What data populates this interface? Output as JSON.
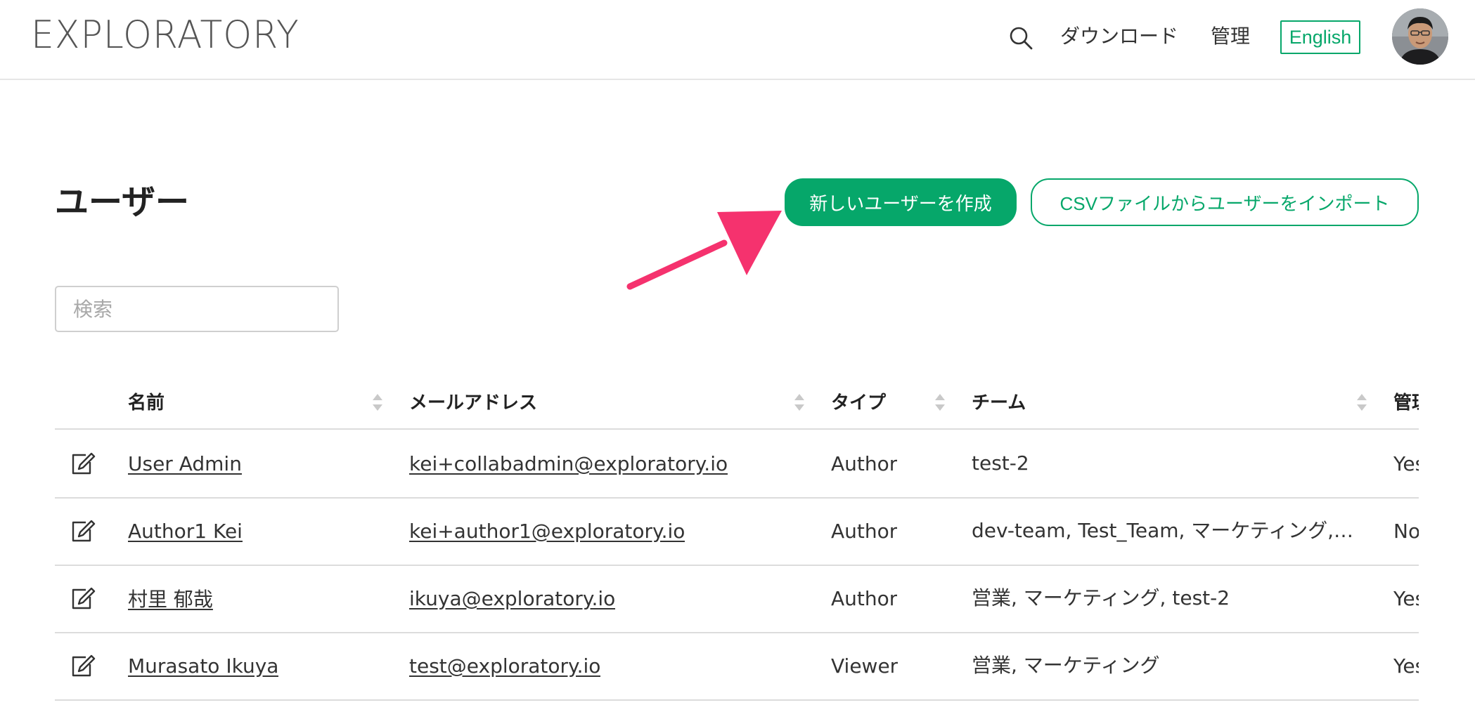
{
  "header": {
    "logo": "EXPLORATORY",
    "nav": {
      "download": "ダウンロード",
      "admin": "管理",
      "language": "English"
    }
  },
  "page": {
    "title": "ユーザー",
    "create_button": "新しいユーザーを作成",
    "import_button": "CSVファイルからユーザーをインポート",
    "search_placeholder": "検索"
  },
  "colors": {
    "accent": "#06a76a",
    "arrow": "#f5326e"
  },
  "table": {
    "columns": [
      "名前",
      "メールアドレス",
      "タイプ",
      "チーム",
      "管理"
    ],
    "rows": [
      {
        "name": "User Admin",
        "email": "kei+collabadmin@exploratory.io",
        "type": "Author",
        "team": "test-2",
        "admin": "Yes"
      },
      {
        "name": "Author1 Kei",
        "email": "kei+author1@exploratory.io",
        "type": "Author",
        "team": "dev-team, Test_Team, マーケティング, 営業",
        "admin": "No"
      },
      {
        "name": "村里 郁哉",
        "email": "ikuya@exploratory.io",
        "type": "Author",
        "team": "営業, マーケティング, test-2",
        "admin": "Yes"
      },
      {
        "name": "Murasato Ikuya",
        "email": "test@exploratory.io",
        "type": "Viewer",
        "team": "営業, マーケティング",
        "admin": "Yes"
      }
    ]
  }
}
